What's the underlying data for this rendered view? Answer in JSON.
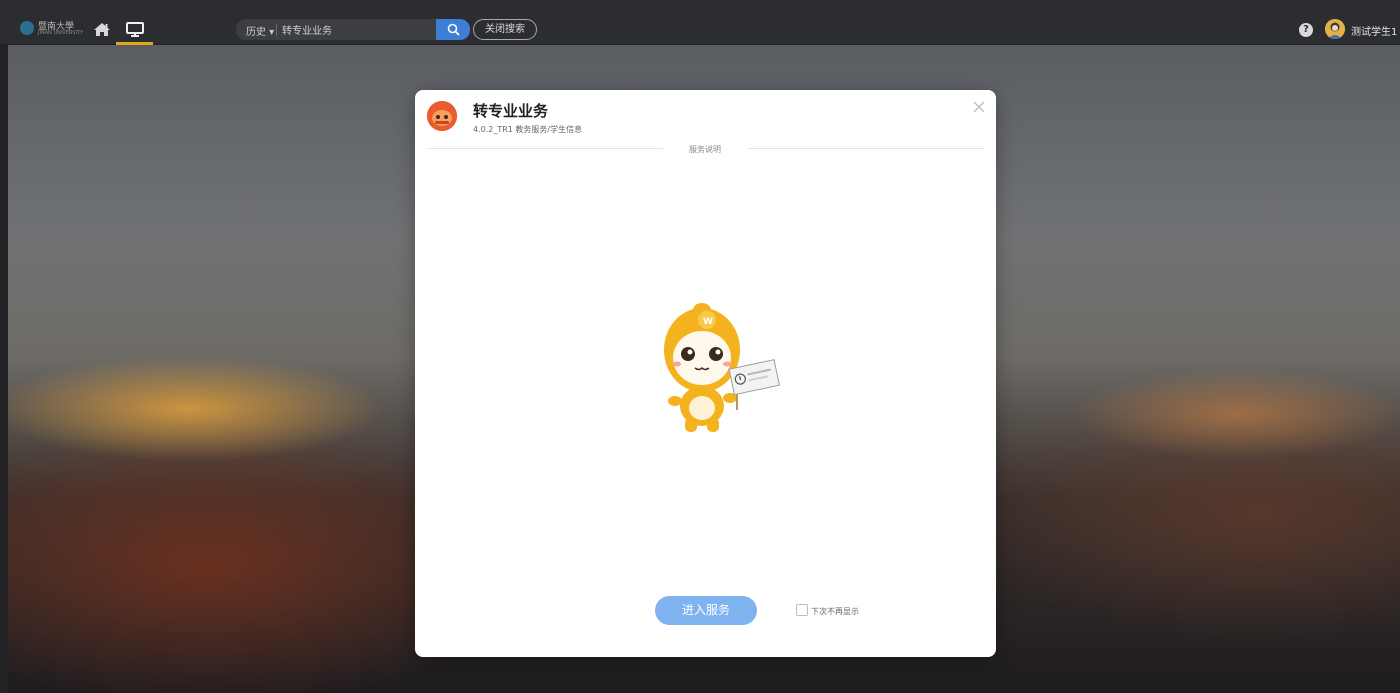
{
  "topbar": {
    "logo_text": "暨南大學",
    "logo_subtext": "JINAN UNIVERSITY",
    "history_label": "历史 ▾",
    "search_value": "转专业业务",
    "close_search_label": "关闭搜索",
    "help_symbol": "?",
    "username": "测试学生1",
    "accent_color": "#e2a71b"
  },
  "modal": {
    "title": "转专业业务",
    "subtitle": "4.0.2_TR1 教务服务/学生信息",
    "section_label": "服务说明",
    "enter_button": "进入服务",
    "dont_show_label": "下次不再显示",
    "button_color": "#7fb3f0",
    "icon_color": "#ea5b30"
  }
}
